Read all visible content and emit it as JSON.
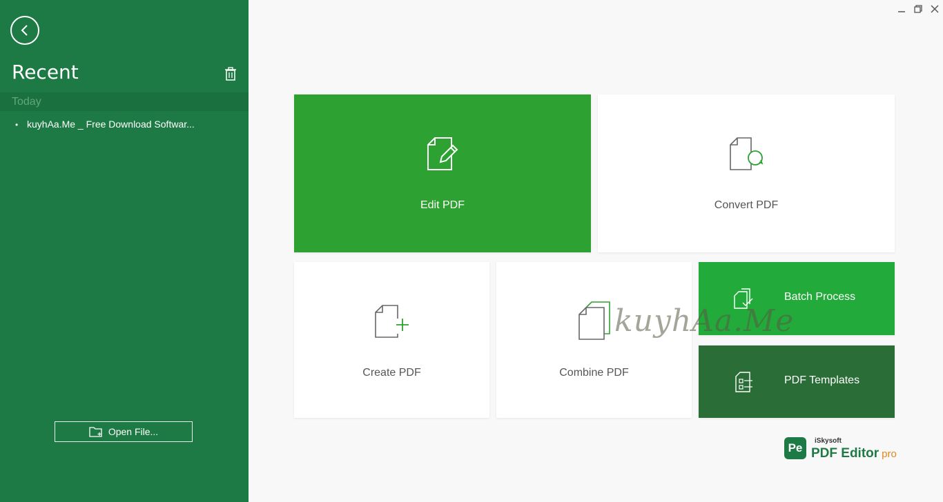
{
  "sidebar": {
    "title": "Recent",
    "section_today": "Today",
    "recent_files": [
      "kuyhAa.Me _ Free Download Softwar..."
    ],
    "open_file_label": "Open File..."
  },
  "tiles": {
    "edit": "Edit PDF",
    "convert": "Convert PDF",
    "create": "Create PDF",
    "combine": "Combine PDF",
    "batch": "Batch Process",
    "templates": "PDF Templates"
  },
  "watermark": "kuyhAa.Me",
  "brand": {
    "logo": "Pe",
    "maker": "iSkysoft",
    "product": "PDF Editor",
    "edition": "pro"
  },
  "colors": {
    "sidebar": "#1e7a44",
    "edit_tile": "#2da131",
    "batch_tile": "#22ab3a",
    "templates_tile": "#2a6d37",
    "accent_orange": "#e2861c"
  },
  "icons": [
    "back-arrow-icon",
    "trash-icon",
    "folder-add-icon",
    "edit-pdf-icon",
    "convert-pdf-icon",
    "create-pdf-icon",
    "combine-pdf-icon",
    "batch-process-icon",
    "pdf-templates-icon",
    "minimize-icon",
    "restore-icon",
    "close-icon"
  ]
}
